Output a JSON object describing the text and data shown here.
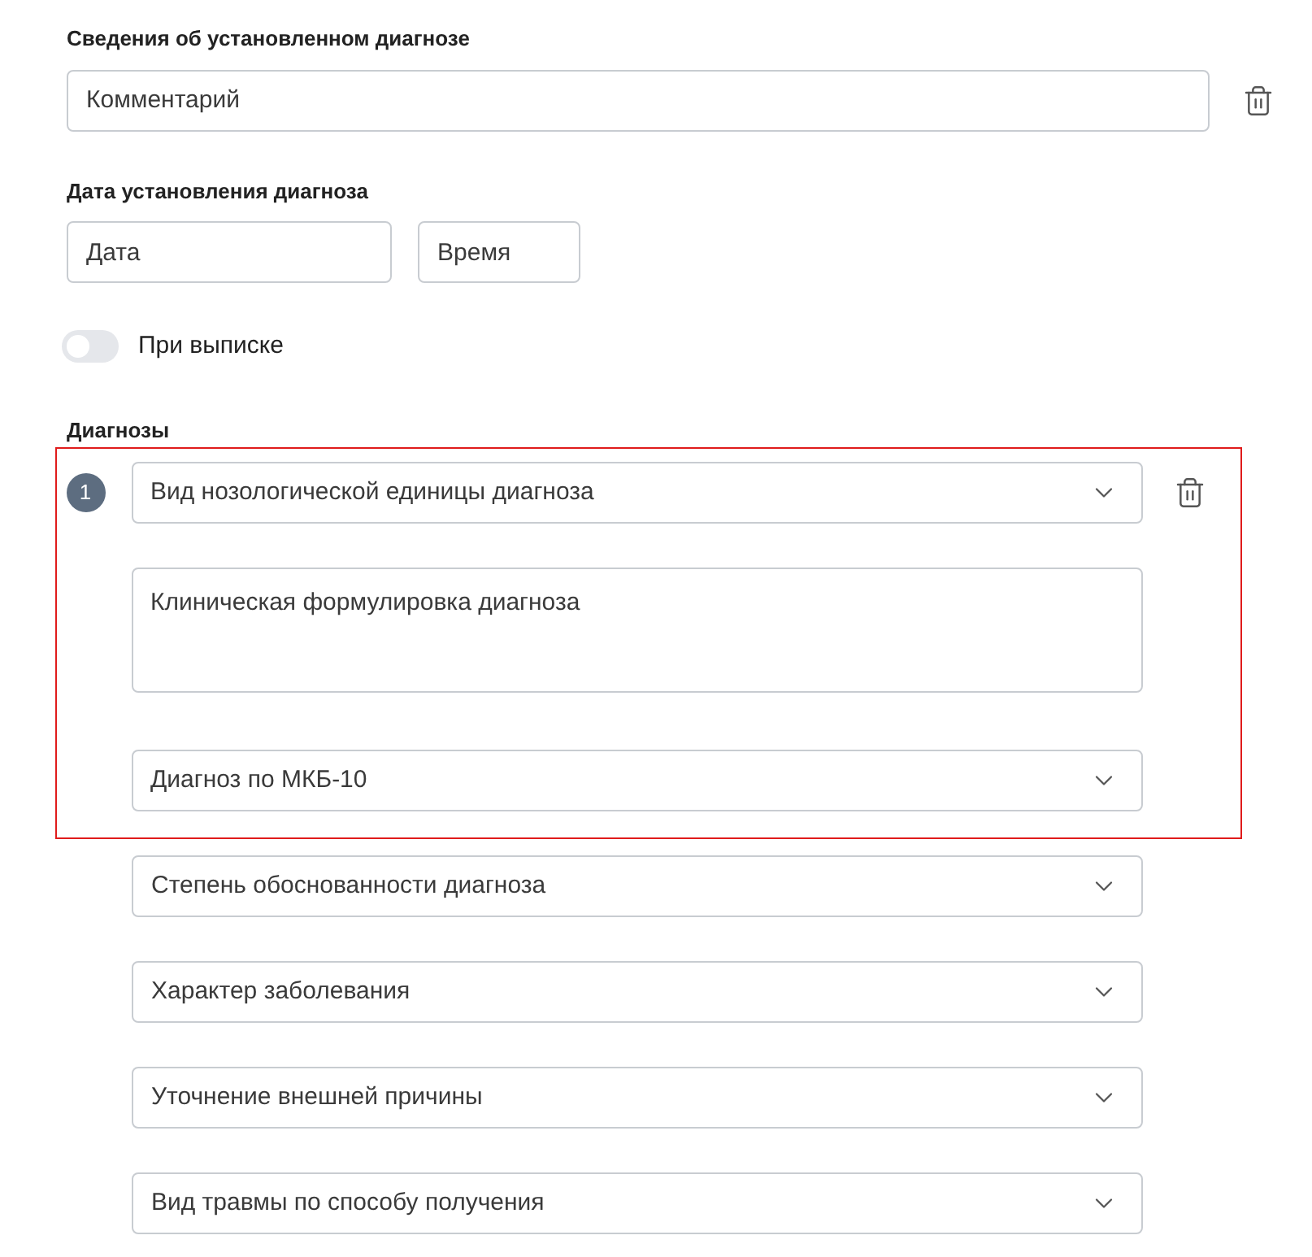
{
  "details": {
    "title": "Сведения об установленном диагнозе",
    "comment": {
      "placeholder": "Комментарий"
    }
  },
  "diagnosis_date": {
    "title": "Дата установления диагноза",
    "date": {
      "placeholder": "Дата"
    },
    "time": {
      "placeholder": "Время"
    }
  },
  "discharge_toggle": {
    "label": "При выписке",
    "on": false
  },
  "diagnoses": {
    "title": "Диагнозы",
    "items": [
      {
        "number": "1",
        "fields": [
          {
            "kind": "select",
            "placeholder": "Вид нозологической единицы диагноза",
            "highlighted": true
          },
          {
            "kind": "textarea",
            "placeholder": "Клиническая формулировка диагноза",
            "highlighted": true
          },
          {
            "kind": "select",
            "placeholder": "Диагноз по МКБ-10",
            "highlighted": true
          },
          {
            "kind": "select",
            "placeholder": "Степень обоснованности диагноза",
            "highlighted": false
          },
          {
            "kind": "select",
            "placeholder": "Характер заболевания",
            "highlighted": false
          },
          {
            "kind": "select",
            "placeholder": "Уточнение внешней причины",
            "highlighted": false
          },
          {
            "kind": "select",
            "placeholder": "Вид травмы по способу получения",
            "highlighted": false
          }
        ]
      }
    ]
  }
}
